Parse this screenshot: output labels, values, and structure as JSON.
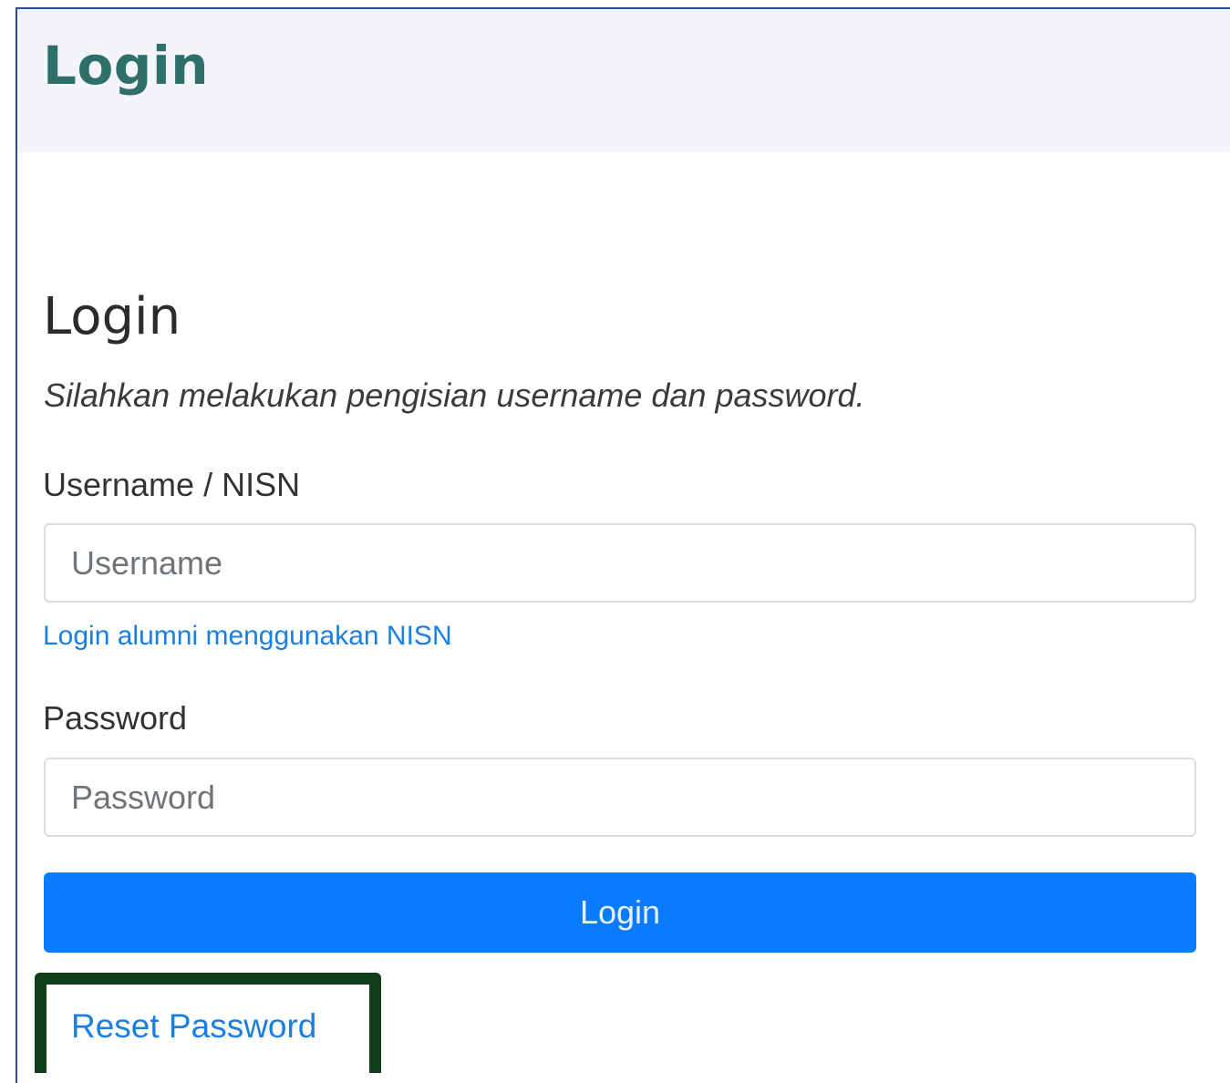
{
  "header": {
    "title": "Login"
  },
  "card": {
    "title": "Login",
    "subtitle": "Silahkan melakukan pengisian username dan password."
  },
  "form": {
    "username_label": "Username / NISN",
    "username_placeholder": "Username",
    "alumni_hint": "Login alumni menggunakan NISN",
    "password_label": "Password",
    "password_placeholder": "Password",
    "submit_label": "Login",
    "reset_label": "Reset Password"
  },
  "colors": {
    "header_bg": "#f4f5fb",
    "header_title": "#2f6f6a",
    "primary": "#0a7bff",
    "link": "#1a7fe0",
    "highlight_border": "#123d1b"
  }
}
